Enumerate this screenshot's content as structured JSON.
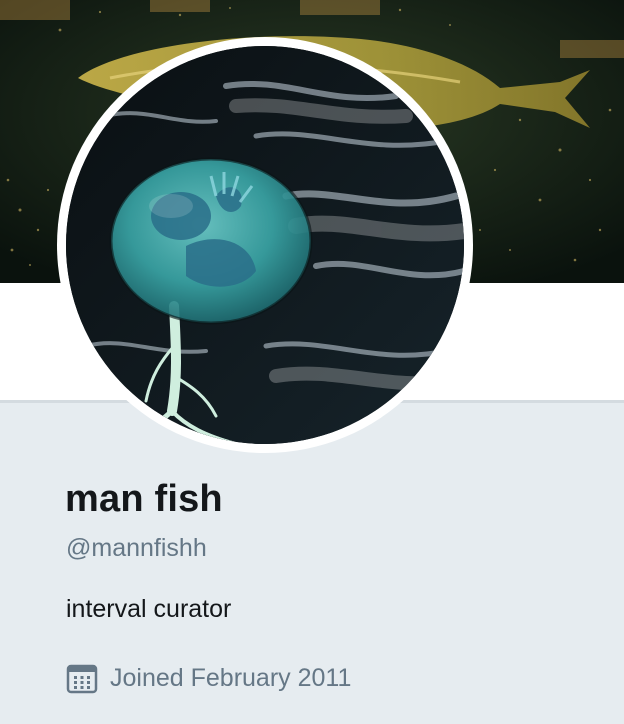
{
  "profile": {
    "name": "man fish",
    "handle": "@mannfishh",
    "bio": "interval curator",
    "joined": "Joined February 2011"
  },
  "icons": {
    "calendar": "calendar-icon"
  },
  "colors": {
    "page_background": "#e6ecf0",
    "name_text": "#14171a",
    "secondary_text": "#657786",
    "avatar_border": "#ffffff"
  }
}
